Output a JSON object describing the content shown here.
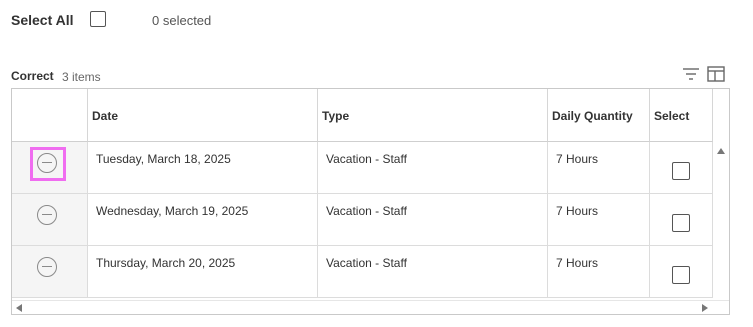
{
  "top": {
    "select_all_label": "Select All",
    "selected_count": "0 selected"
  },
  "section": {
    "title": "Correct",
    "count": "3 items",
    "icons": [
      "filter-icon",
      "layout-columns-icon"
    ]
  },
  "table": {
    "columns": [
      "",
      "Date",
      "Type",
      "Daily Quantity",
      "Select"
    ],
    "rows": [
      {
        "date": "Tuesday, March 18, 2025",
        "type": "Vacation - Staff",
        "quantity": "7 Hours",
        "selected": false,
        "focused": true
      },
      {
        "date": "Wednesday, March 19, 2025",
        "type": "Vacation - Staff",
        "quantity": "7 Hours",
        "selected": false,
        "focused": false
      },
      {
        "date": "Thursday, March 20, 2025",
        "type": "Vacation - Staff",
        "quantity": "7 Hours",
        "selected": false,
        "focused": false
      }
    ]
  },
  "colors": {
    "focus_ring": "#f06df0",
    "row_action_bg": "#f5f5f5",
    "border": "#c9c9c9"
  }
}
